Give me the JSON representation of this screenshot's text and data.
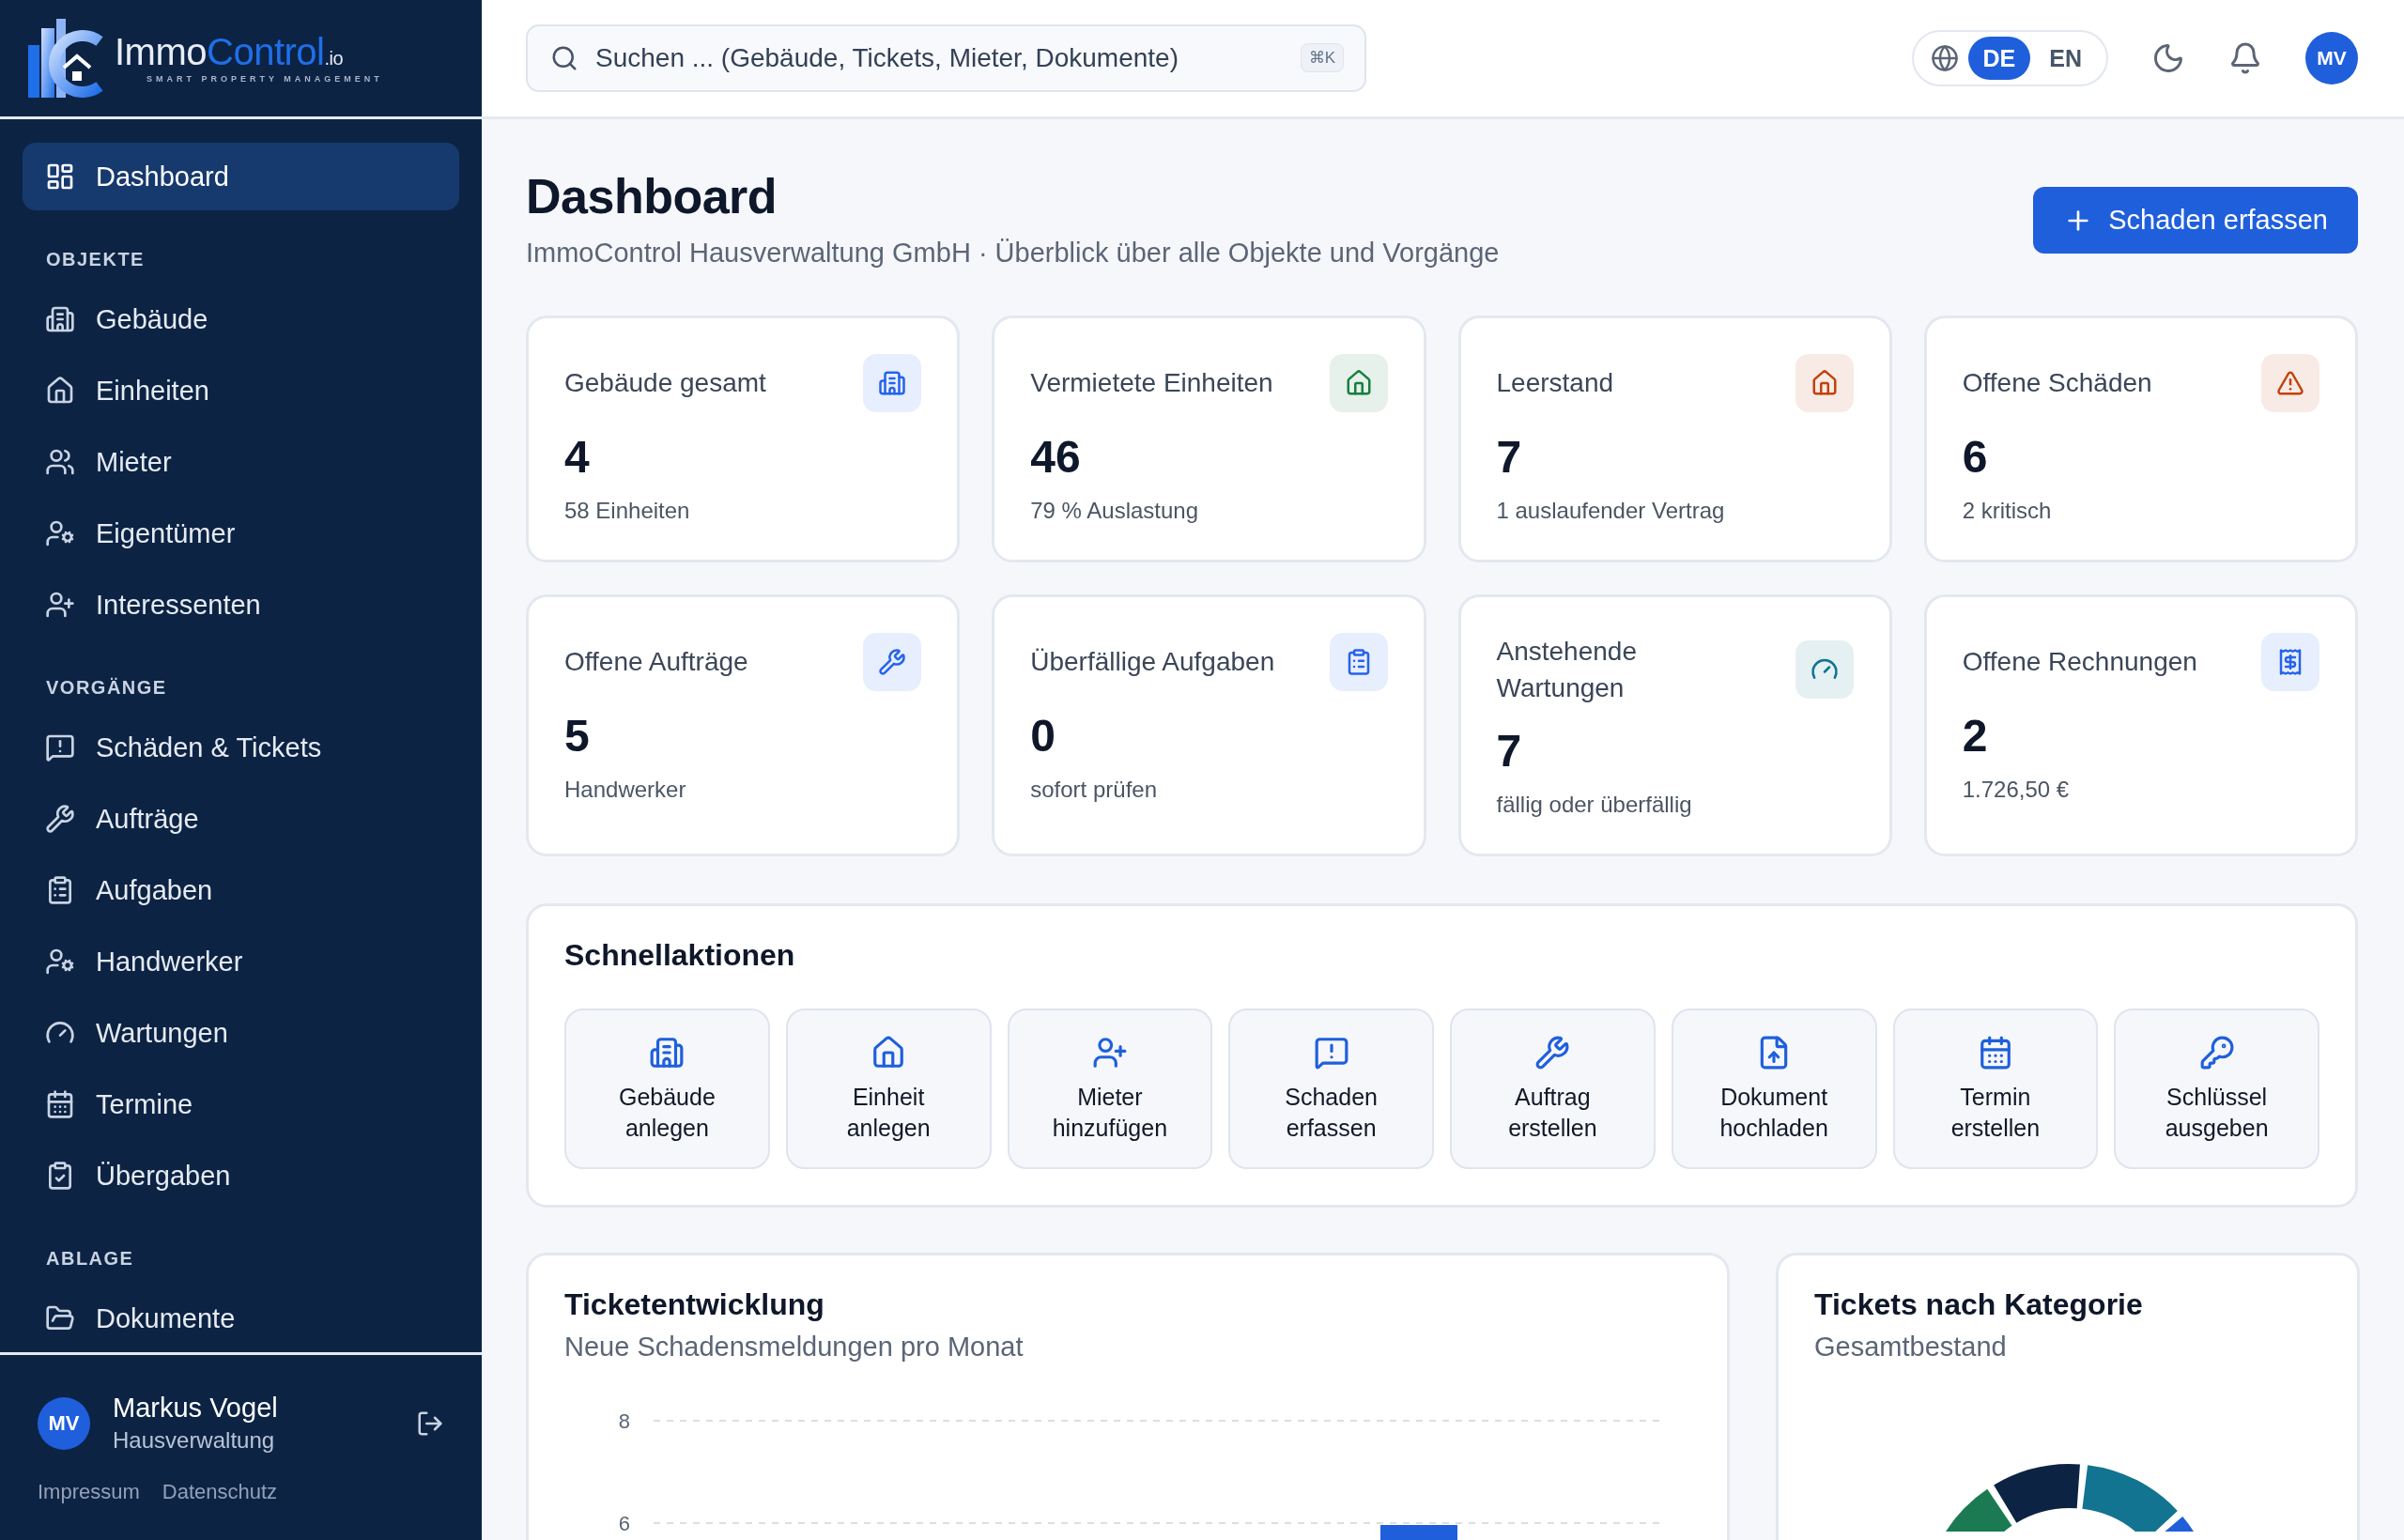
{
  "sidebar": {
    "logo": {
      "name_part_1": "Immo",
      "name_part_2": "Control",
      "suffix": ".io",
      "tagline": "SMART PROPERTY MANAGEMENT"
    },
    "items": [
      {
        "label": "Dashboard",
        "selected": true
      }
    ],
    "sections": [
      {
        "title": "OBJEKTE",
        "items": [
          {
            "label": "Gebäude",
            "selected": false
          },
          {
            "label": "Einheiten",
            "selected": false
          },
          {
            "label": "Mieter",
            "selected": false
          },
          {
            "label": "Eigentümer",
            "selected": false
          },
          {
            "label": "Interessenten",
            "selected": false
          }
        ]
      },
      {
        "title": "VORGÄNGE",
        "items": [
          {
            "label": "Schäden & Tickets",
            "selected": false
          },
          {
            "label": "Aufträge",
            "selected": false
          },
          {
            "label": "Aufgaben",
            "selected": false
          },
          {
            "label": "Handwerker",
            "selected": false
          },
          {
            "label": "Wartungen",
            "selected": false
          },
          {
            "label": "Termine",
            "selected": false
          },
          {
            "label": "Übergaben",
            "selected": false
          }
        ]
      },
      {
        "title": "ABLAGE",
        "items": [
          {
            "label": "Dokumente",
            "selected": false
          }
        ]
      }
    ],
    "user": {
      "initials": "MV",
      "name": "Markus Vogel",
      "role": "Hausverwaltung"
    },
    "footer_links": [
      "Impressum",
      "Datenschutz"
    ]
  },
  "topbar": {
    "search": {
      "placeholder": "Suchen ... (Gebäude, Tickets, Mieter, Dokumente)",
      "shortcut": "⌘K"
    },
    "languages": [
      {
        "label": "DE",
        "selected": true
      },
      {
        "label": "EN",
        "selected": false
      }
    ],
    "avatar": "MV"
  },
  "page": {
    "title": "Dashboard",
    "subtitle": "ImmoControl Hausverwaltung GmbH · Überblick über alle Objekte und Vorgänge",
    "primary_button": "Schaden erfassen"
  },
  "stats": [
    {
      "label": "Gebäude gesamt",
      "value": "4",
      "note": "58 Einheiten",
      "color": "#2563eb"
    },
    {
      "label": "Vermietete Einheiten",
      "value": "46",
      "note": "79 % Auslastung",
      "color": "#15803d"
    },
    {
      "label": "Leerstand",
      "value": "7",
      "note": "1 auslaufender Vertrag",
      "color": "#c2410c"
    },
    {
      "label": "Offene Schäden",
      "value": "6",
      "note": "2 kritisch",
      "color": "#c2410c"
    },
    {
      "label": "Offene Aufträge",
      "value": "5",
      "note": "Handwerker",
      "color": "#2563eb"
    },
    {
      "label": "Überfällige Aufgaben",
      "value": "0",
      "note": "sofort prüfen",
      "color": "#2563eb"
    },
    {
      "label": "Anstehende Wartungen",
      "value": "7",
      "note": "fällig oder überfällig",
      "color": "#0e7490"
    },
    {
      "label": "Offene Rechnungen",
      "value": "2",
      "note": "1.726,50 €",
      "color": "#2563eb"
    }
  ],
  "quick_actions": {
    "title": "Schnellaktionen",
    "actions": [
      {
        "line_1": "Gebäude",
        "line_2": "anlegen"
      },
      {
        "line_1": "Einheit",
        "line_2": "anlegen"
      },
      {
        "line_1": "Mieter",
        "line_2": "hinzufügen"
      },
      {
        "line_1": "Schaden",
        "line_2": "erfassen"
      },
      {
        "line_1": "Auftrag",
        "line_2": "erstellen"
      },
      {
        "line_1": "Dokument",
        "line_2": "hochladen"
      },
      {
        "line_1": "Termin",
        "line_2": "erstellen"
      },
      {
        "line_1": "Schlüssel",
        "line_2": "ausgeben"
      }
    ]
  },
  "ticket_chart": {
    "title": "Ticketentwicklung",
    "subtitle": "Neue Schadensmeldungen pro Monat",
    "y_ticks": [
      "8",
      "6"
    ]
  },
  "category_chart": {
    "title": "Tickets nach Kategorie",
    "subtitle": "Gesamtbestand"
  }
}
